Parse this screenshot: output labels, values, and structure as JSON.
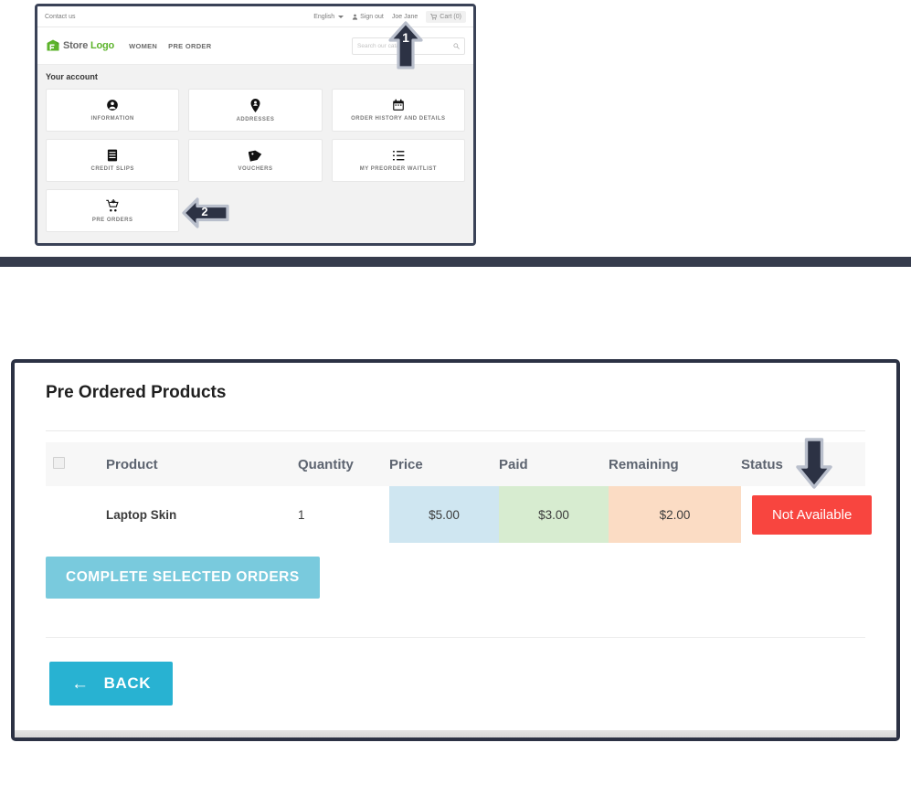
{
  "top_panel": {
    "topbar": {
      "contact_label": "Contact us",
      "language_label": "English",
      "signout_label": "Sign out",
      "user_name": "Joe Jane",
      "cart_label": "Cart (0)",
      "icons": {
        "user": "user-icon",
        "cart": "cart-icon",
        "caret": "chevron-down-icon"
      }
    },
    "header": {
      "logo_text_1": "Store ",
      "logo_text_2": "Logo",
      "logo_icon": "store-logo-icon",
      "nav_items": [
        "WOMEN",
        "PRE ORDER"
      ],
      "search_placeholder": "Search our catalog",
      "search_icon": "search-icon"
    },
    "account": {
      "section_title": "Your account",
      "tiles": [
        {
          "label": "INFORMATION",
          "icon": "person-circle-icon"
        },
        {
          "label": "ADDRESSES",
          "icon": "map-pin-person-icon"
        },
        {
          "label": "ORDER HISTORY AND DETAILS",
          "icon": "calendar-icon"
        },
        {
          "label": "CREDIT SLIPS",
          "icon": "document-lines-icon"
        },
        {
          "label": "VOUCHERS",
          "icon": "tag-icon"
        },
        {
          "label": "MY PREORDER WAITLIST",
          "icon": "list-icon"
        },
        {
          "label": "PRE ORDERS",
          "icon": "cart-plus-icon"
        }
      ]
    }
  },
  "bottom_panel": {
    "title": "Pre Ordered Products",
    "table": {
      "select_all_checkbox": "select-all-checkbox",
      "columns": [
        "",
        "Product",
        "Quantity",
        "Price",
        "Paid",
        "Remaining",
        "Status"
      ],
      "rows": [
        {
          "checked": false,
          "product": "Laptop Skin",
          "quantity": "1",
          "price": "$5.00",
          "paid": "$3.00",
          "remaining": "$2.00",
          "status": "Not Available"
        }
      ]
    },
    "complete_button": "COMPLETE SELECTED ORDERS",
    "back_button": "BACK",
    "back_icon": "arrow-left-icon"
  },
  "annotations": [
    {
      "id": "1",
      "direction": "up",
      "label": "1"
    },
    {
      "id": "2",
      "direction": "left",
      "label": "2"
    },
    {
      "id": "3",
      "direction": "down",
      "label": ""
    }
  ],
  "colors": {
    "accent_blue": "#28b2d2",
    "accent_blue_light": "#79cadd",
    "status_red": "#f8453f",
    "price_cell": "#cfe6f1",
    "paid_cell": "#d7ecd0",
    "remaining_cell": "#fbdcc4",
    "frame_navy": "#2c3244",
    "logo_green": "#5cb32b"
  }
}
